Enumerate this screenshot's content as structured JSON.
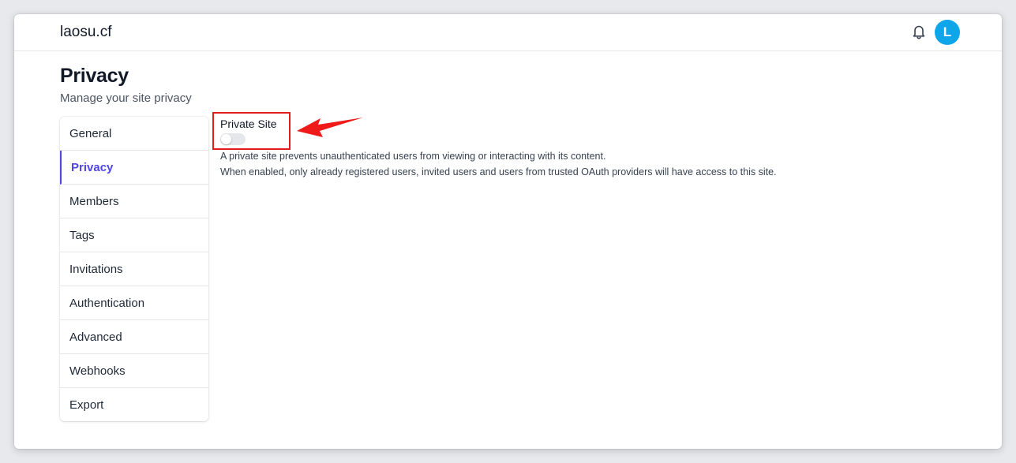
{
  "header": {
    "site_name": "laosu.cf",
    "bell_icon": "bell-icon",
    "avatar_letter": "L",
    "avatar_color": "#0ea5e9"
  },
  "page": {
    "title": "Privacy",
    "subtitle": "Manage your site privacy"
  },
  "sidebar": {
    "active_color": "#4f46e5",
    "items": [
      {
        "label": "General"
      },
      {
        "label": "Privacy",
        "active": true
      },
      {
        "label": "Members"
      },
      {
        "label": "Tags"
      },
      {
        "label": "Invitations"
      },
      {
        "label": "Authentication"
      },
      {
        "label": "Advanced"
      },
      {
        "label": "Webhooks"
      },
      {
        "label": "Export"
      }
    ]
  },
  "setting": {
    "label": "Private Site",
    "enabled": false,
    "description_1": "A private site prevents unauthenticated users from viewing or interacting with its content.",
    "description_2": "When enabled, only already registered users, invited users and users from trusted OAuth providers will have access to this site."
  },
  "annotation": {
    "highlight_color": "#e11d1d",
    "arrow_icon": "red-arrow-icon"
  }
}
